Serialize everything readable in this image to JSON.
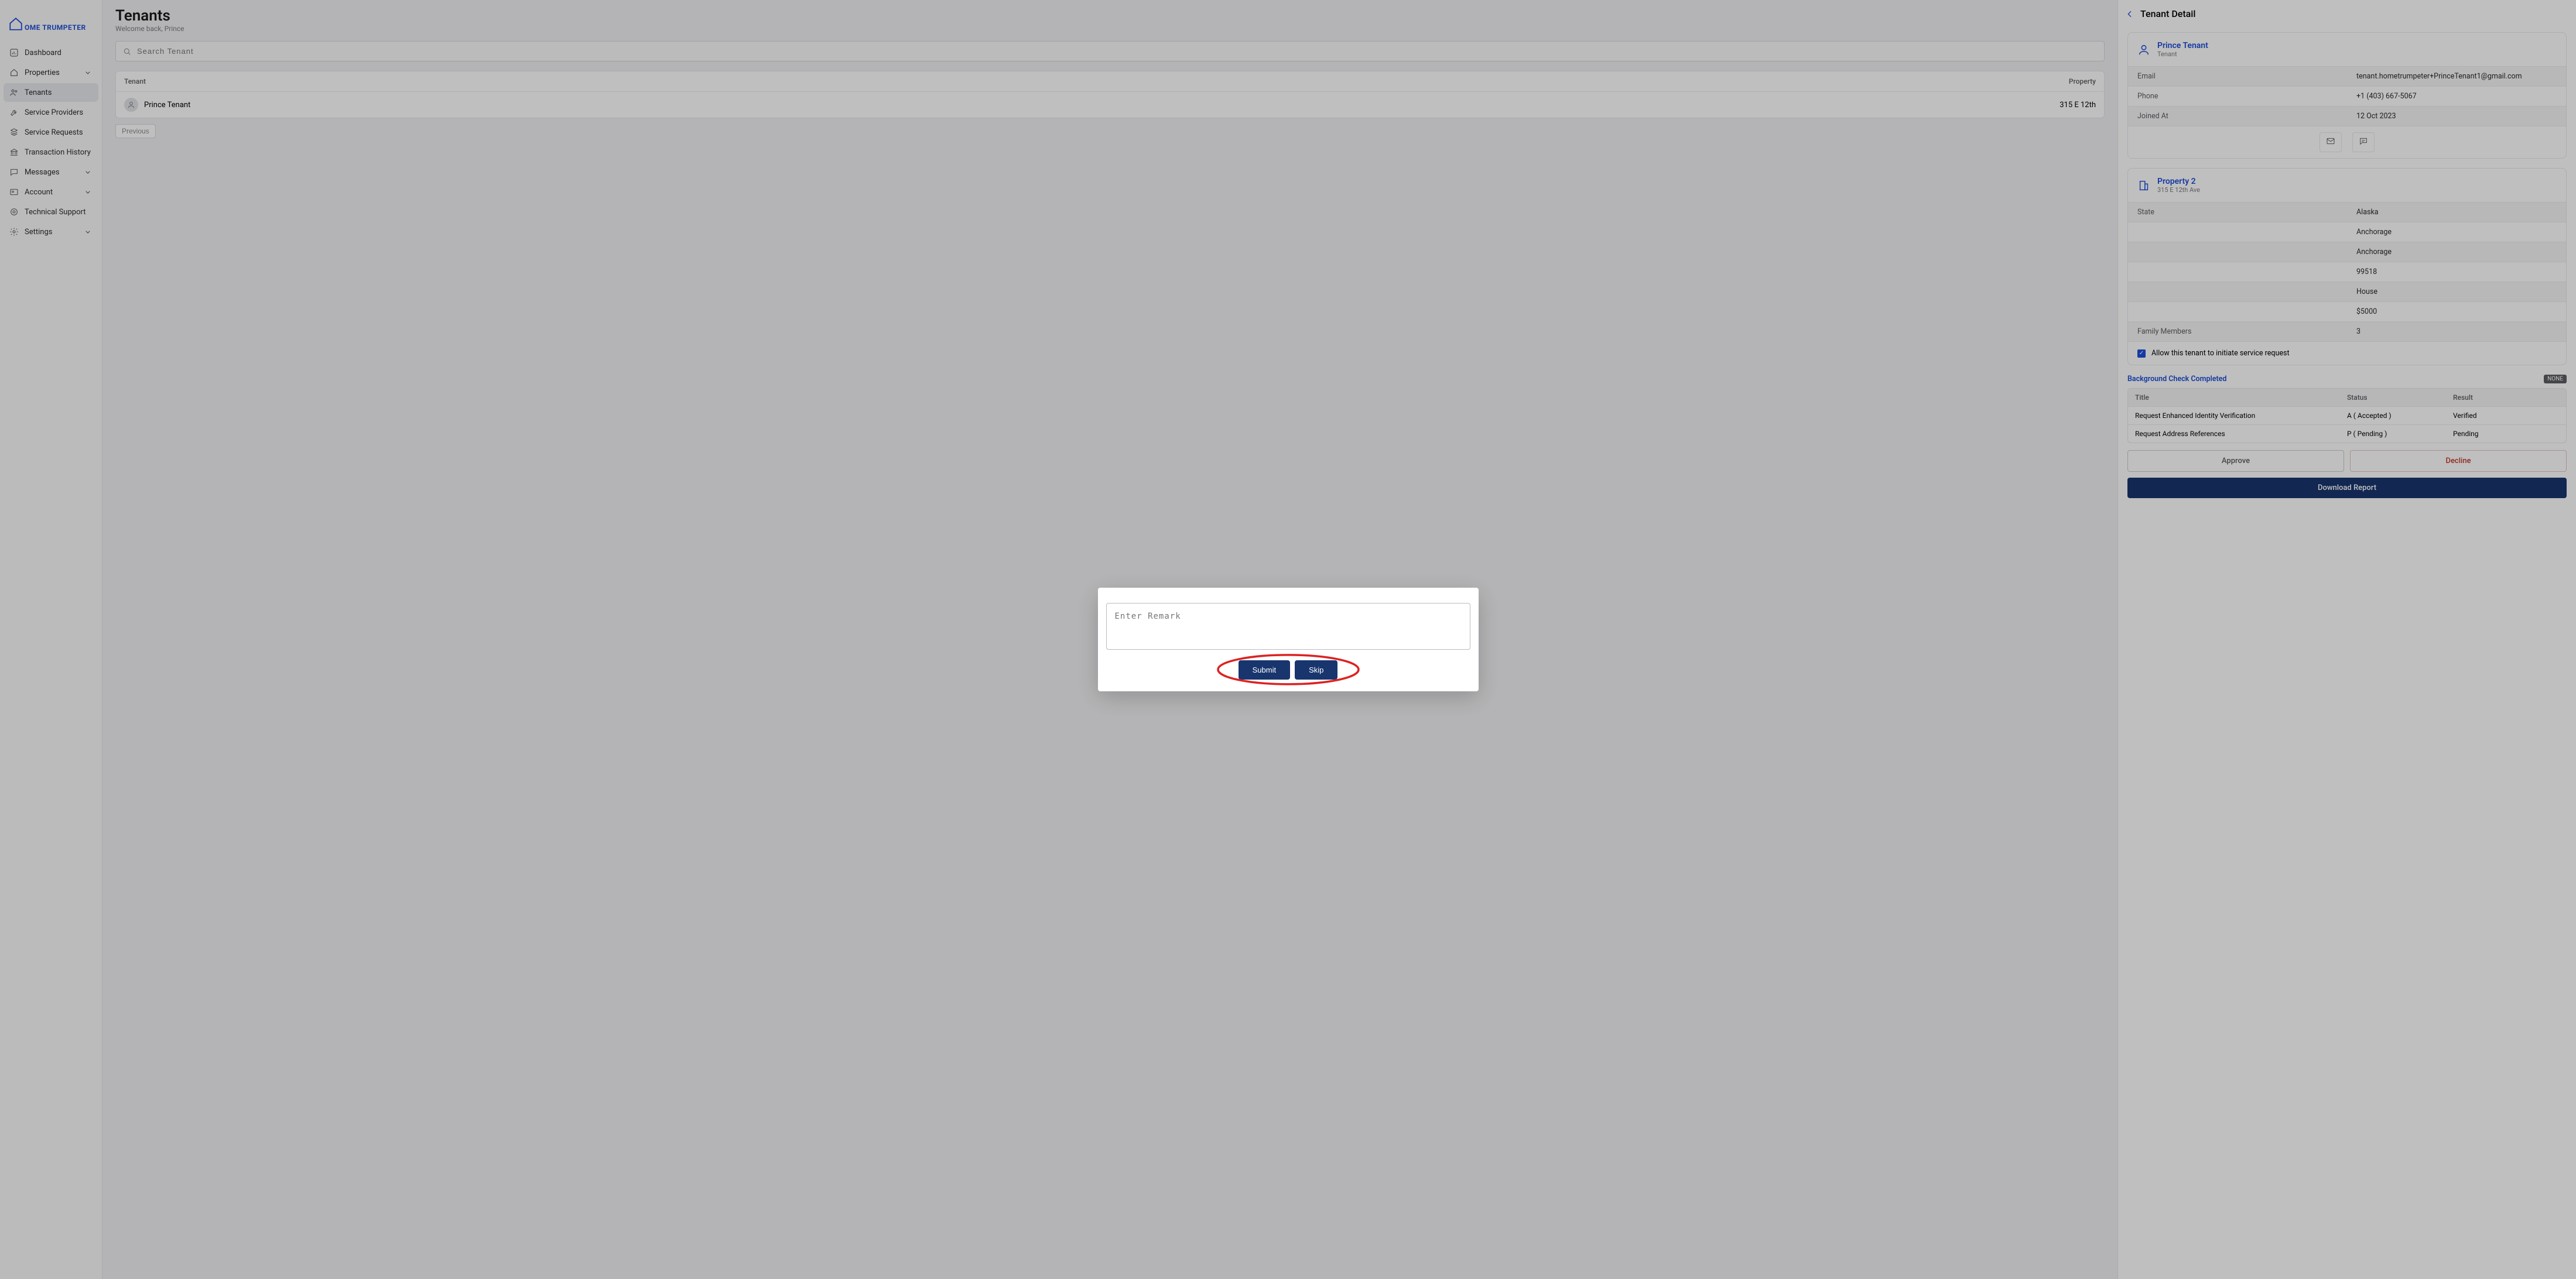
{
  "brand": {
    "name": "OME TRUMPETER"
  },
  "nav": {
    "dashboard": "Dashboard",
    "properties": "Properties",
    "tenants": "Tenants",
    "service_providers": "Service Providers",
    "service_requests": "Service Requests",
    "transaction_history": "Transaction History",
    "messages": "Messages",
    "account": "Account",
    "tech_support": "Technical Support",
    "settings": "Settings"
  },
  "page": {
    "title": "Tenants",
    "subtitle": "Welcome back, Prince"
  },
  "search": {
    "placeholder": "Search Tenant"
  },
  "list": {
    "col_tenant": "Tenant",
    "col_property": "Property",
    "rows": [
      {
        "name": "Prince Tenant",
        "property": "315 E 12th"
      }
    ],
    "previous": "Previous"
  },
  "detail": {
    "title": "Tenant Detail",
    "tenant": {
      "name": "Prince Tenant",
      "role": "Tenant",
      "kv": [
        {
          "k": "Email",
          "v": "tenant.hometrumpeter+PrinceTenant1@gmail.com"
        },
        {
          "k": "Phone",
          "v": "+1 (403) 667-5067"
        },
        {
          "k": "Joined At",
          "v": "12 Oct 2023"
        }
      ]
    },
    "property": {
      "name": "Property 2",
      "addr": "315 E 12th Ave",
      "kv": [
        {
          "k": "State",
          "v": "Alaska"
        },
        {
          "k": "",
          "v": "Anchorage"
        },
        {
          "k": "",
          "v": "Anchorage"
        },
        {
          "k": "",
          "v": "99518"
        },
        {
          "k": "",
          "v": "House"
        },
        {
          "k": "",
          "v": "$5000"
        },
        {
          "k": "Family Members",
          "v": "3"
        }
      ],
      "allow_label": "Allow this tenant to initiate service request"
    },
    "bg": {
      "title": "Background Check Completed",
      "none": "NONE",
      "cols": {
        "title": "Title",
        "status": "Status",
        "result": "Result"
      },
      "rows": [
        {
          "title": "Request Enhanced Identity Verification",
          "status": "A ( Accepted )",
          "result": "Verified"
        },
        {
          "title": "Request Address References",
          "status": "P ( Pending )",
          "result": "Pending"
        }
      ]
    },
    "actions": {
      "approve": "Approve",
      "decline": "Decline",
      "download": "Download Report"
    }
  },
  "modal": {
    "placeholder": "Enter Remark",
    "submit": "Submit",
    "skip": "Skip"
  }
}
